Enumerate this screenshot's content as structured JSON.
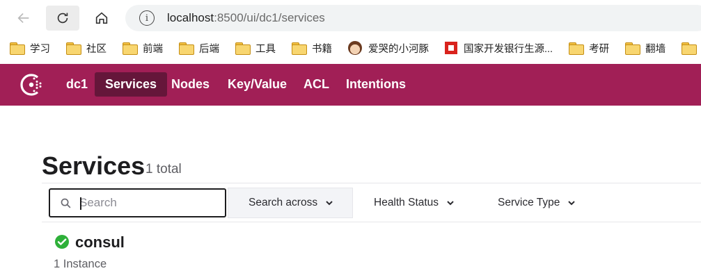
{
  "browser": {
    "url_host": "localhost",
    "url_path": ":8500/ui/dc1/services",
    "bookmarks": [
      {
        "label": "学习",
        "icon": "folder-icon"
      },
      {
        "label": "社区",
        "icon": "folder-icon"
      },
      {
        "label": "前端",
        "icon": "folder-icon"
      },
      {
        "label": "后端",
        "icon": "folder-icon"
      },
      {
        "label": "工具",
        "icon": "folder-icon"
      },
      {
        "label": "书籍",
        "icon": "folder-icon"
      },
      {
        "label": "爱哭的小河豚",
        "icon": "avatar-icon"
      },
      {
        "label": "国家开发银行生源...",
        "icon": "bank-logo-icon"
      },
      {
        "label": "考研",
        "icon": "folder-icon"
      },
      {
        "label": "翻墙",
        "icon": "folder-icon"
      }
    ]
  },
  "header": {
    "datacenter": "dc1",
    "nav": [
      "Services",
      "Nodes",
      "Key/Value",
      "ACL",
      "Intentions"
    ],
    "active": "Services",
    "brand_color": "#a11f56"
  },
  "page": {
    "title": "Services",
    "total": "1 total"
  },
  "filters": {
    "search_placeholder": "Search",
    "search_value": "",
    "search_across": "Search across",
    "health_status": "Health Status",
    "service_type": "Service Type"
  },
  "services": [
    {
      "name": "consul",
      "instances": "1 Instance",
      "status": "passing",
      "status_color": "#2eb039"
    }
  ]
}
